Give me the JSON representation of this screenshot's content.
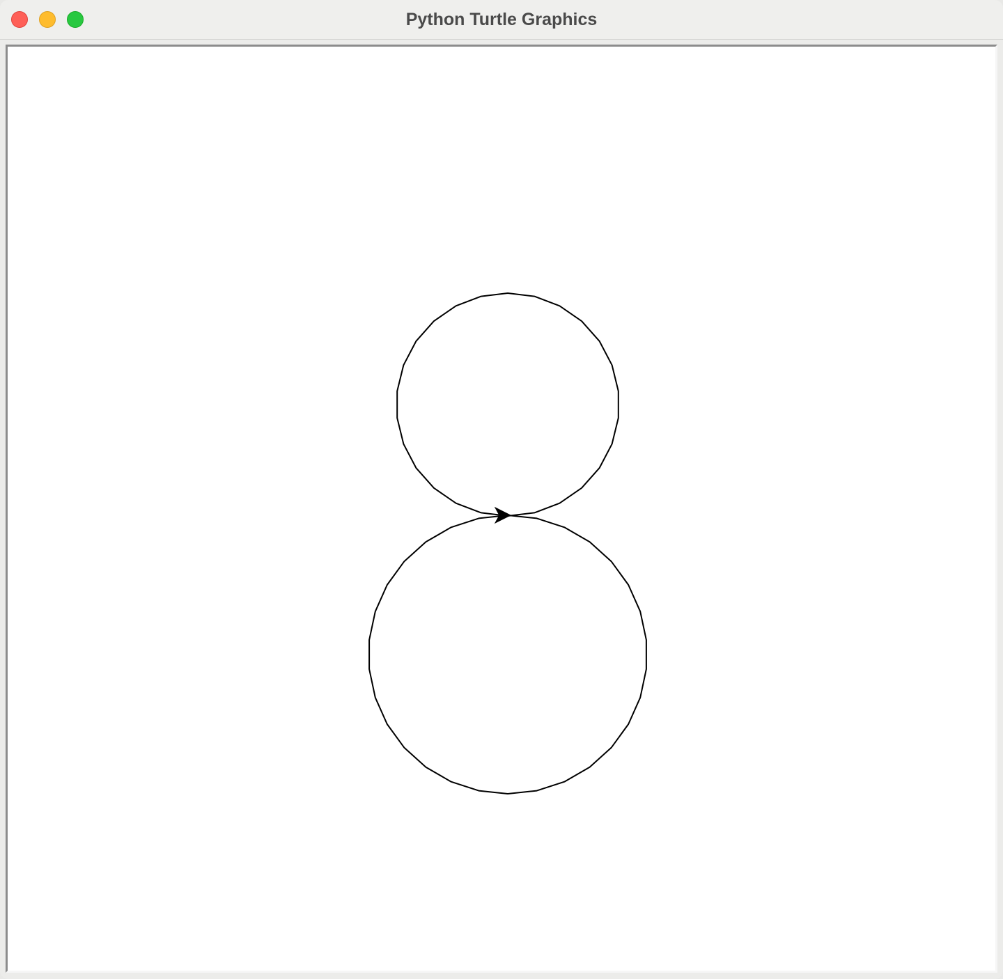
{
  "window": {
    "title": "Python Turtle Graphics",
    "controls": {
      "close_color": "#fe5f57",
      "minimize_color": "#febc2e",
      "zoom_color": "#28c840"
    }
  },
  "canvas": {
    "background": "#ffffff",
    "pen_color": "#000000",
    "drawing": "two tangent circles forming a figure eight",
    "turtle": {
      "shape": "arrow",
      "heading": "east"
    }
  }
}
